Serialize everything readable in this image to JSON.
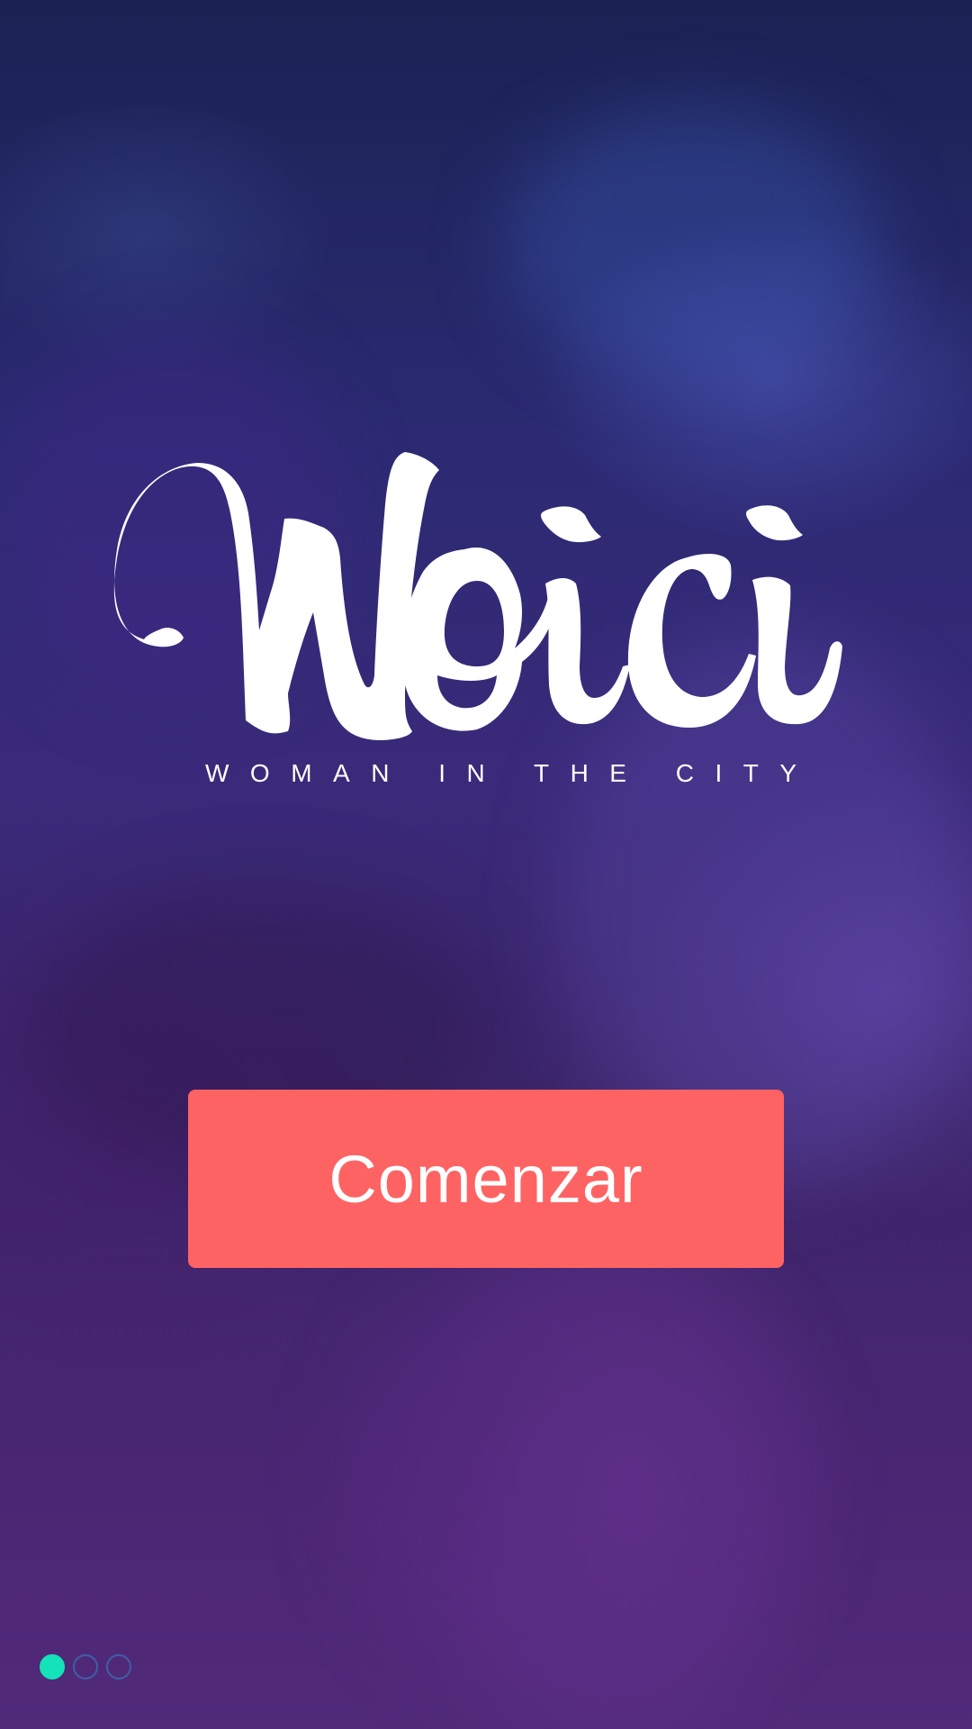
{
  "brand": {
    "logo_text": "Woici",
    "tagline": "WOMAN IN THE CITY"
  },
  "cta": {
    "label": "Comenzar"
  },
  "pagination": {
    "total": 3,
    "current": 1,
    "active_color": "#14e2b8"
  },
  "colors": {
    "cta_background": "#fe6363",
    "text": "#ffffff"
  }
}
